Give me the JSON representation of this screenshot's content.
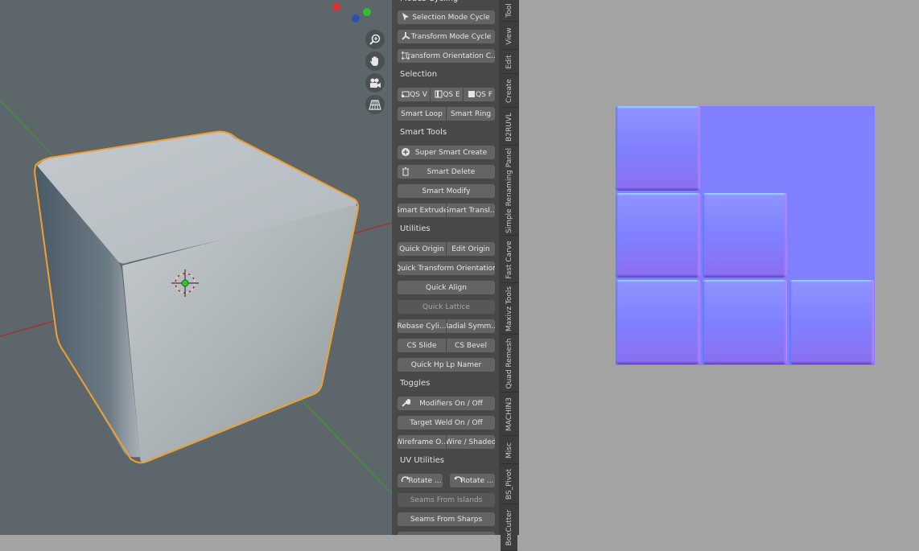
{
  "sidebar": {
    "sections": {
      "mode_cycling": "Modes Cycling",
      "selection": "Selection",
      "smart_tools": "Smart Tools",
      "utilities": "Utilities",
      "toggles": "Toggles",
      "uv_utilities": "UV Utilities"
    },
    "buttons": {
      "selection_mode_cycle": "Selection Mode Cycle",
      "transform_mode_cycle": "Transform Mode Cycle",
      "transform_orientation": "Transform Orientation C...",
      "qs_v": "QS V",
      "qs_e": "QS E",
      "qs_f": "QS F",
      "smart_loop": "Smart Loop",
      "smart_ring": "Smart Ring",
      "super_smart_create": "Super Smart Create",
      "smart_delete": "Smart Delete",
      "smart_modify": "Smart Modify",
      "smart_extrude": "Smart Extrude",
      "smart_translate": "Smart Transl...",
      "quick_origin": "Quick Origin",
      "edit_origin": "Edit Origin",
      "quick_transform_orientation": "Quick Transform Orientation",
      "quick_align": "Quick Align",
      "quick_lattice": "Quick Lattice",
      "rebase_cylinder": "Rebase Cyli...",
      "radial_symmetry": "Radial Symm...",
      "cs_slide": "CS Slide",
      "cs_bevel": "CS Bevel",
      "quick_hp_lp_namer": "Quick Hp Lp Namer",
      "modifiers_on_off": "Modifiers On / Off",
      "target_weld_on_off": "Target Weld On / Off",
      "wireframe_overlay": "Wireframe O...",
      "wire_shaded": "Wire / Shaded",
      "rotate_cw": "Rotate ...",
      "rotate_ccw": "Rotate ...",
      "seams_from_islands": "Seams From Islands",
      "seams_from_sharps": "Seams From Sharps"
    }
  },
  "tabs": [
    "Tool",
    "View",
    "Edit",
    "Create",
    "B2RUVL",
    "Simple Renaming Panel",
    "Fast Carve",
    "Maxivz Tools",
    "Quad Remesh",
    "MACHIN3",
    "Misc",
    "BS_Pivot",
    "BoxCutter"
  ],
  "viewport": {
    "nav_icons": [
      "zoom-icon",
      "hand-pan-icon",
      "camera-icon",
      "grid-perspective-icon"
    ]
  },
  "colors": {
    "viewport_bg": "#5d666a",
    "selection_outline": "#f0a030",
    "x_axis": "#c02828",
    "y_axis": "#3c9a2c",
    "normal_map_base": "#8080ff"
  }
}
